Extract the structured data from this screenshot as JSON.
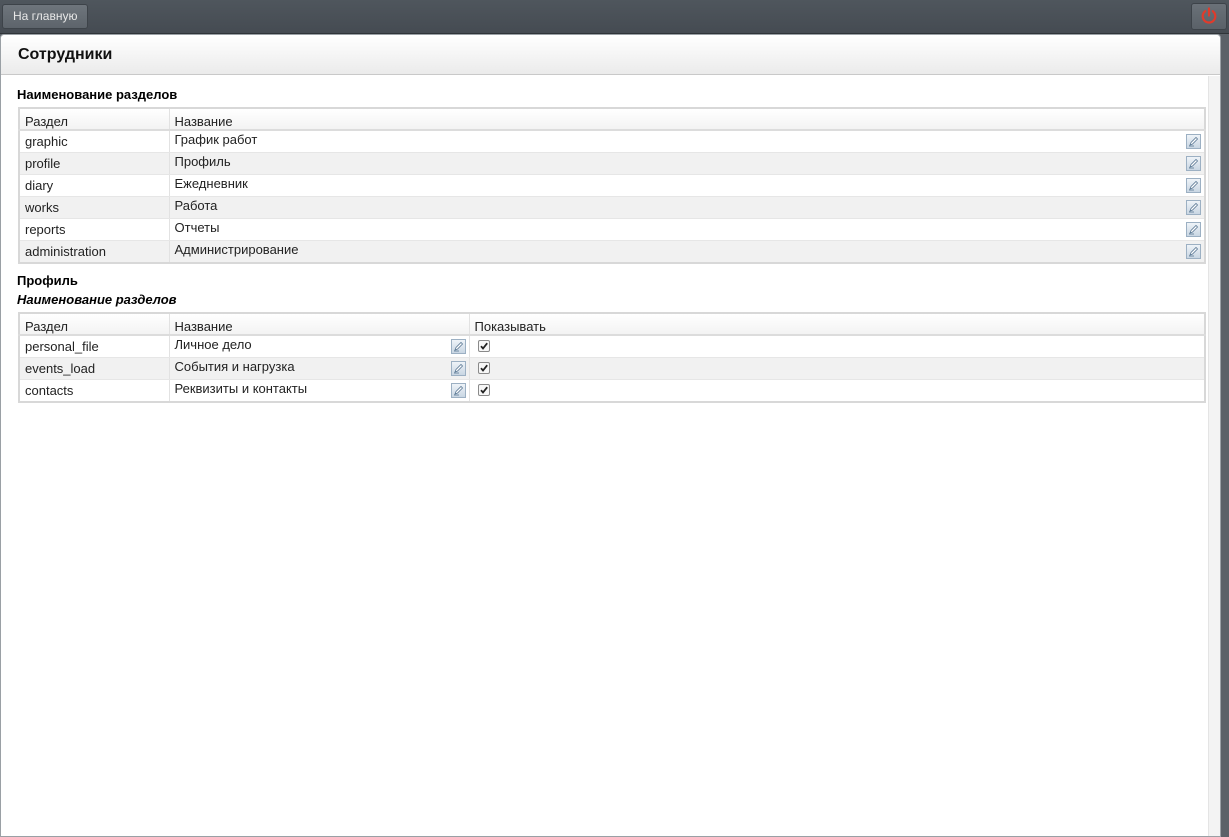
{
  "topbar": {
    "home_label": "На главную",
    "power_icon": "power-icon",
    "power_color": "#e03b2b"
  },
  "window": {
    "title": "Сотрудники"
  },
  "sections_table": {
    "title": "Наименование разделов",
    "columns": [
      "Раздел",
      "Название"
    ],
    "rows": [
      {
        "key": "graphic",
        "name": "График работ"
      },
      {
        "key": "profile",
        "name": "Профиль"
      },
      {
        "key": "diary",
        "name": "Ежедневник"
      },
      {
        "key": "works",
        "name": "Работа"
      },
      {
        "key": "reports",
        "name": "Отчеты"
      },
      {
        "key": "administration",
        "name": "Администрирование"
      }
    ]
  },
  "profile_table": {
    "title": "Профиль",
    "subtitle": "Наименование разделов",
    "columns": [
      "Раздел",
      "Название",
      "Показывать"
    ],
    "rows": [
      {
        "key": "personal_file",
        "name": "Личное дело",
        "show": true
      },
      {
        "key": "events_load",
        "name": "События и нагрузка",
        "show": true
      },
      {
        "key": "contacts",
        "name": "Реквизиты и контакты",
        "show": true
      }
    ]
  }
}
